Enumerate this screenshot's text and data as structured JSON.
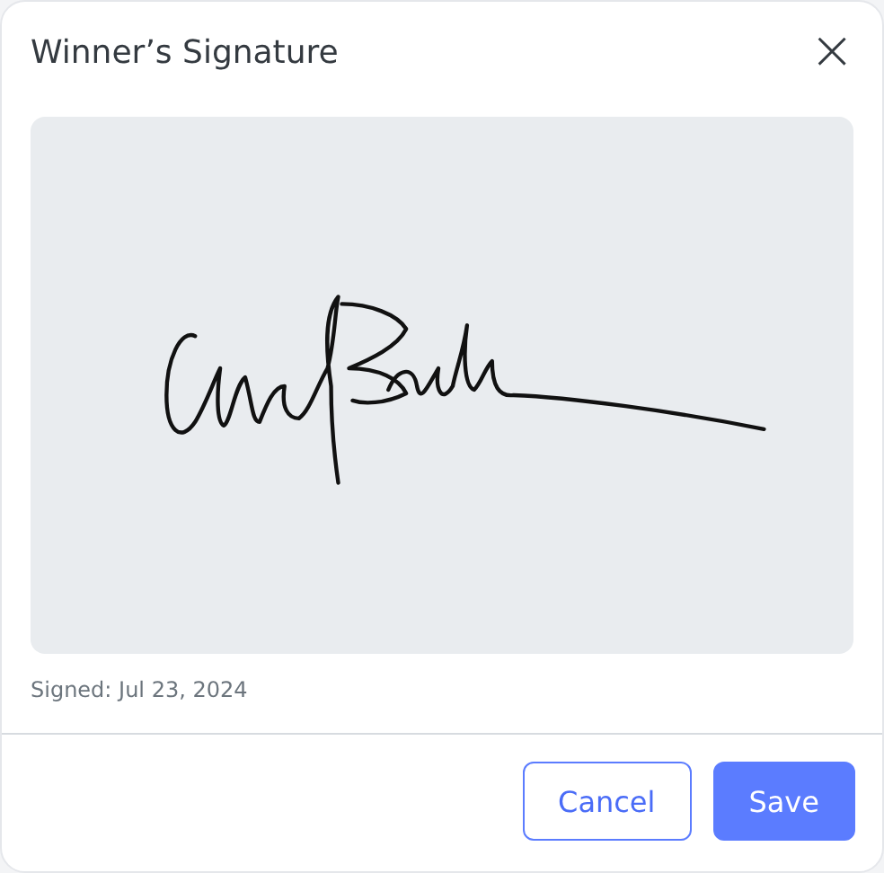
{
  "dialog": {
    "title": "Winner’s Signature",
    "close_icon": "×"
  },
  "signature": {
    "signed_label": "Signed: Jul 23, 2024"
  },
  "buttons": [
    {
      "label": "Cancel",
      "kind": "secondary"
    },
    {
      "label": "Save",
      "kind": "primary"
    }
  ]
}
